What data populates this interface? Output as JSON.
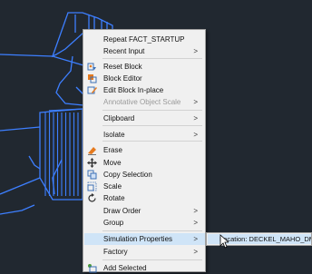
{
  "context_menu": {
    "items": [
      {
        "label": "Repeat FACT_STARTUP",
        "submenu": false,
        "disabled": false,
        "icon": ""
      },
      {
        "label": "Recent Input",
        "submenu": true,
        "disabled": false,
        "icon": ""
      },
      {
        "label": "Reset Block",
        "submenu": false,
        "disabled": false,
        "icon": "reset-block-icon"
      },
      {
        "label": "Block Editor",
        "submenu": false,
        "disabled": false,
        "icon": "block-editor-icon"
      },
      {
        "label": "Edit Block In-place",
        "submenu": false,
        "disabled": false,
        "icon": "edit-block-in-place-icon"
      },
      {
        "label": "Annotative Object Scale",
        "submenu": true,
        "disabled": true,
        "icon": ""
      },
      {
        "label": "Clipboard",
        "submenu": true,
        "disabled": false,
        "icon": ""
      },
      {
        "label": "Isolate",
        "submenu": true,
        "disabled": false,
        "icon": ""
      },
      {
        "label": "Erase",
        "submenu": false,
        "disabled": false,
        "icon": "erase-icon"
      },
      {
        "label": "Move",
        "submenu": false,
        "disabled": false,
        "icon": "move-icon"
      },
      {
        "label": "Copy Selection",
        "submenu": false,
        "disabled": false,
        "icon": "copy-selection-icon"
      },
      {
        "label": "Scale",
        "submenu": false,
        "disabled": false,
        "icon": "scale-icon"
      },
      {
        "label": "Rotate",
        "submenu": false,
        "disabled": false,
        "icon": "rotate-icon"
      },
      {
        "label": "Draw Order",
        "submenu": true,
        "disabled": false,
        "icon": ""
      },
      {
        "label": "Group",
        "submenu": true,
        "disabled": false,
        "icon": ""
      },
      {
        "label": "Simulation Properties",
        "submenu": true,
        "disabled": false,
        "icon": "",
        "highlighted": true
      },
      {
        "label": "Factory",
        "submenu": true,
        "disabled": false,
        "icon": ""
      },
      {
        "label": "Add Selected",
        "submenu": false,
        "disabled": false,
        "icon": "add-selected-icon"
      }
    ],
    "arrow_glyph": ">"
  },
  "submenu": {
    "item_label": "Location: DECKEL_MAHO_DMU"
  },
  "colors": {
    "background": "#212830",
    "drawing_lines": "#3d7fff",
    "menu_bg": "#f0f0f0",
    "highlight": "#cfe4f7"
  }
}
